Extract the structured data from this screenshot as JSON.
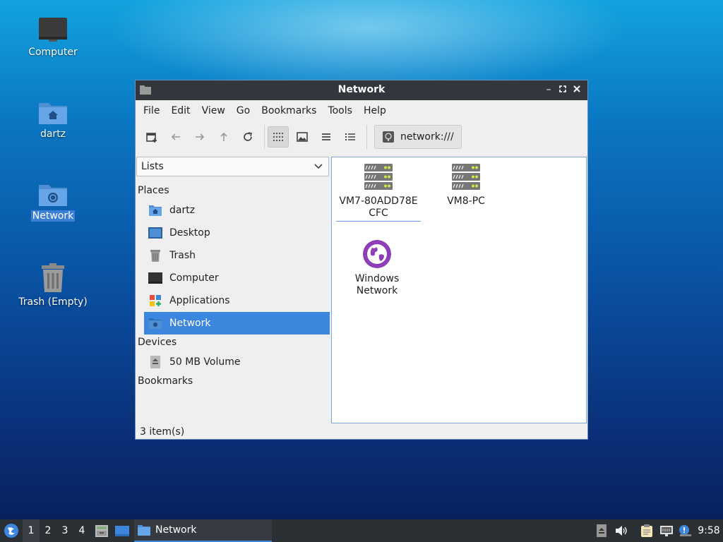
{
  "desktop": {
    "icons": [
      {
        "label": "Computer",
        "icon": "computer-icon"
      },
      {
        "label": "dartz",
        "icon": "home-folder-icon"
      },
      {
        "label": "Network",
        "icon": "network-folder-icon"
      },
      {
        "label": "Trash (Empty)",
        "icon": "trash-icon"
      }
    ]
  },
  "window": {
    "title": "Network",
    "menu": [
      "File",
      "Edit",
      "View",
      "Go",
      "Bookmarks",
      "Tools",
      "Help"
    ],
    "toolbar": {
      "icons": [
        "new-tab-icon",
        "back-icon",
        "forward-icon",
        "up-icon",
        "reload-icon",
        "icon-view-icon",
        "thumbnail-view-icon",
        "compact-view-icon",
        "detailed-list-icon"
      ],
      "path": "network:///"
    },
    "sidebar": {
      "mode": "Lists",
      "places_heading": "Places",
      "places": [
        {
          "label": "dartz",
          "icon": "home-folder-icon"
        },
        {
          "label": "Desktop",
          "icon": "desktop-icon"
        },
        {
          "label": "Trash",
          "icon": "trash-icon"
        },
        {
          "label": "Computer",
          "icon": "computer-icon"
        },
        {
          "label": "Applications",
          "icon": "applications-icon"
        },
        {
          "label": "Network",
          "icon": "network-icon"
        }
      ],
      "devices_heading": "Devices",
      "devices": [
        {
          "label": "50 MB Volume",
          "icon": "drive-icon"
        }
      ],
      "bookmarks_heading": "Bookmarks"
    },
    "files": [
      {
        "label_line1": "VM7-80ADD78E",
        "label_line2": "CFC",
        "icon": "server-icon"
      },
      {
        "label_line1": "VM8-PC",
        "label_line2": "",
        "icon": "server-icon"
      },
      {
        "label_line1": "Windows",
        "label_line2": "Network",
        "icon": "globe-icon"
      }
    ],
    "status": "3 item(s)"
  },
  "taskbar": {
    "workspaces": [
      "1",
      "2",
      "3",
      "4"
    ],
    "active_task": "Network",
    "clock": "9:58"
  },
  "colors": {
    "accent": "#3d86de",
    "titlebar": "#32373d",
    "taskbar": "#2b3035"
  }
}
